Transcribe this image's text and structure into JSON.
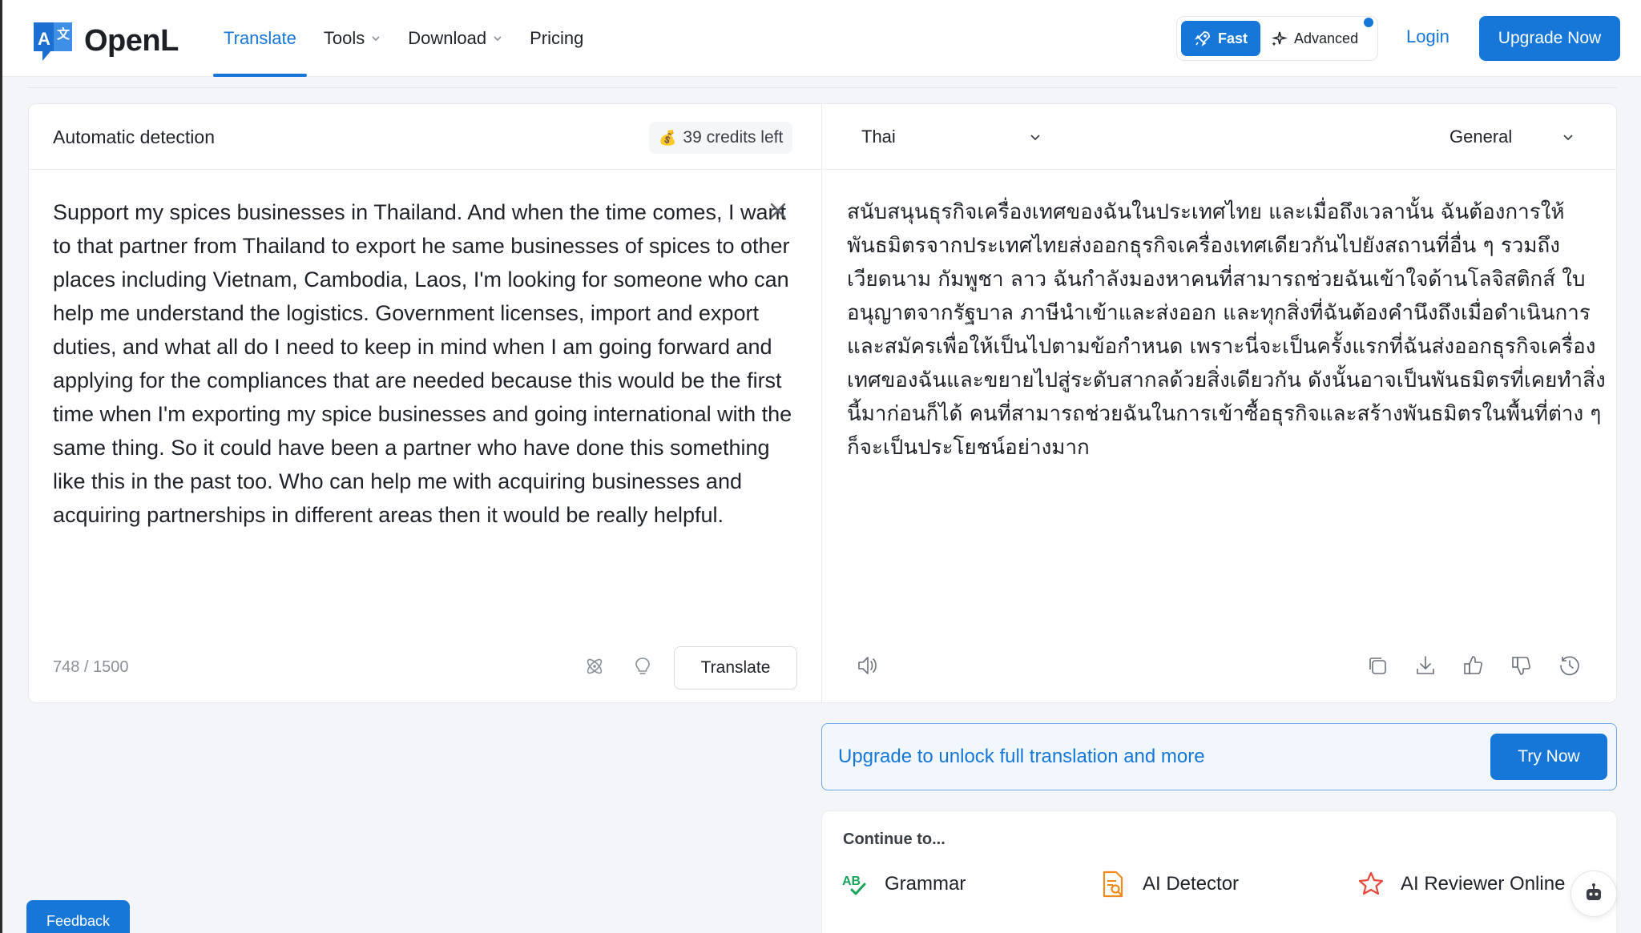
{
  "app": {
    "name": "OpenL"
  },
  "nav": {
    "items": [
      {
        "label": "Translate",
        "active": true
      },
      {
        "label": "Tools",
        "dropdown": true
      },
      {
        "label": "Download",
        "dropdown": true
      },
      {
        "label": "Pricing"
      }
    ]
  },
  "mode": {
    "fast": "Fast",
    "advanced": "Advanced"
  },
  "header": {
    "login": "Login",
    "upgrade": "Upgrade Now"
  },
  "source": {
    "language": "Automatic detection",
    "credits": "39 credits left",
    "text": "Support my spices businesses in Thailand. And when the time comes, I want to that partner from Thailand to export he same businesses of spices to other places including Vietnam, Cambodia, Laos, I'm looking for someone who can help me understand the logistics. Government licenses, import and export duties, and what all do I need to keep in mind when I am going forward and applying for the compliances that are needed because this would be the first time when I'm exporting my spice businesses and going international with the same thing. So it could have been a partner who have done this something like this in the past too. Who can help me with acquiring businesses and acquiring partnerships in different areas then it would be really helpful.",
    "counter": "748 / 1500",
    "translate_button": "Translate"
  },
  "target": {
    "language": "Thai",
    "style": "General",
    "text": "สนับสนุนธุรกิจเครื่องเทศของฉันในประเทศไทย และเมื่อถึงเวลานั้น ฉันต้องการให้พันธมิตรจากประเทศไทยส่งออกธุรกิจเครื่องเทศเดียวกันไปยังสถานที่อื่น ๆ รวมถึงเวียดนาม กัมพูชา ลาว ฉันกำลังมองหาคนที่สามารถช่วยฉันเข้าใจด้านโลจิสติกส์ ใบอนุญาตจากรัฐบาล ภาษีนำเข้าและส่งออก และทุกสิ่งที่ฉันต้องคำนึงถึงเมื่อดำเนินการและสมัครเพื่อให้เป็นไปตามข้อกำหนด เพราะนี่จะเป็นครั้งแรกที่ฉันส่งออกธุรกิจเครื่องเทศของฉันและขยายไปสู่ระดับสากลด้วยสิ่งเดียวกัน ดังนั้นอาจเป็นพันธมิตรที่เคยทำสิ่งนี้มาก่อนก็ได้ คนที่สามารถช่วยฉันในการเข้าซื้อธุรกิจและสร้างพันธมิตรในพื้นที่ต่าง ๆ ก็จะเป็นประโยชน์อย่างมาก"
  },
  "banner": {
    "text": "Upgrade to unlock full translation and more",
    "button": "Try Now"
  },
  "continue": {
    "title": "Continue to...",
    "tools": [
      {
        "label": "Grammar",
        "icon": "grammar-icon"
      },
      {
        "label": "AI Detector",
        "icon": "ai-detector-icon"
      },
      {
        "label": "AI Reviewer Online",
        "icon": "ai-reviewer-icon"
      }
    ]
  },
  "feedback": "Feedback",
  "colors": {
    "accent": "#1677d8",
    "grammar": "#19a35b",
    "detector": "#f08a1c",
    "reviewer": "#e5483a"
  }
}
